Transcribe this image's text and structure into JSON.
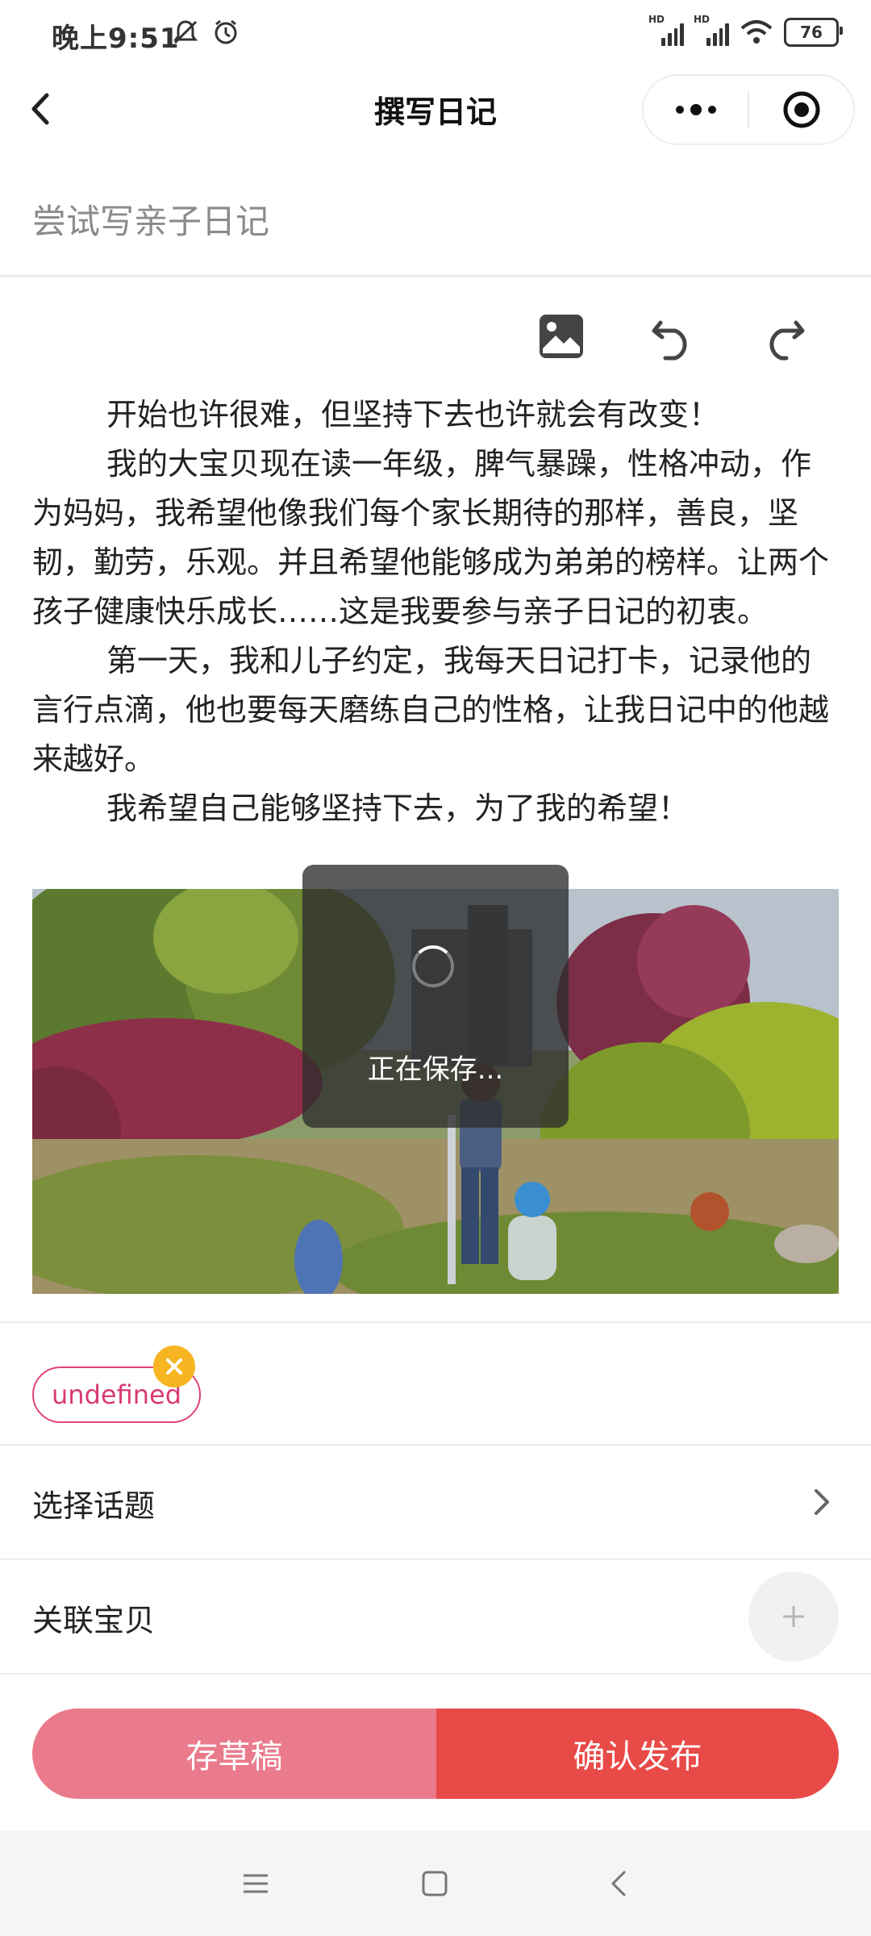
{
  "status_bar": {
    "time": "晚上9:51",
    "left_icons": [
      "mute-icon",
      "alarm-icon"
    ],
    "signal_label": "HD",
    "battery": "76"
  },
  "header": {
    "title": "撰写日记"
  },
  "diary": {
    "title_placeholder": "尝试写亲子日记",
    "paragraphs": [
      "开始也许很难，但坚持下去也许就会有改变！",
      "我的大宝贝现在读一年级，脾气暴躁，性格冲动，作为妈妈，我希望他像我们每个家长期待的那样，善良，坚韧，勤劳，乐观。并且希望他能够成为弟弟的榜样。让两个孩子健康快乐成长……这是我要参与亲子日记的初衷。",
      "第一天，我和儿子约定，我每天日记打卡，记录他的言行点滴，他也要每天磨练自己的性格，让我日记中的他越来越好。",
      "我希望自己能够坚持下去，为了我的希望！"
    ]
  },
  "toast": {
    "text": "正在保存..."
  },
  "tags": [
    {
      "label": "undefined"
    }
  ],
  "rows": {
    "topic_label": "选择话题",
    "baby_label": "关联宝贝"
  },
  "actions": {
    "draft_label": "存草稿",
    "publish_label": "确认发布"
  },
  "colors": {
    "draft": "#ea7b8c",
    "publish": "#e84a48",
    "tag_border": "#e0437b",
    "tag_close": "#f7b522"
  }
}
